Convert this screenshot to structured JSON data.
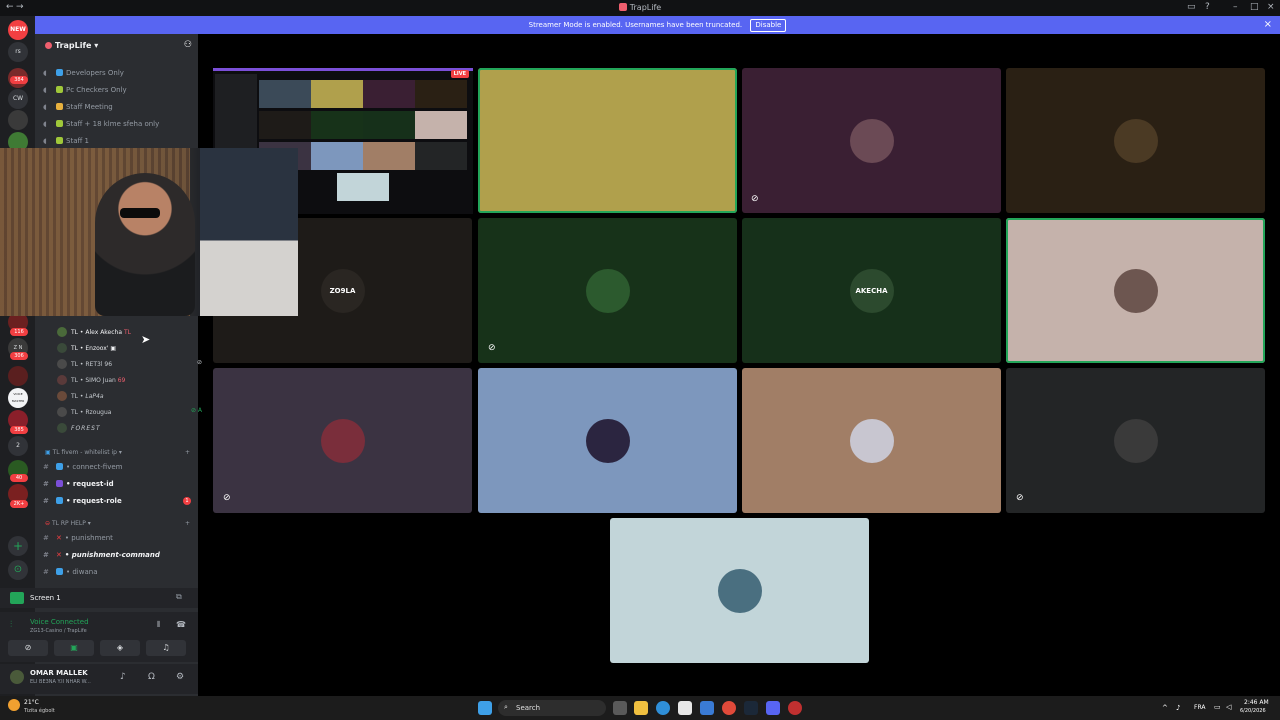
{
  "titlebar": {
    "title": "TrapLife"
  },
  "banner": {
    "text": "Streamer Mode is enabled. Usernames have been truncated.",
    "disable_label": "Disable",
    "close_icon": "close-icon"
  },
  "guilds": [
    {
      "label": "NEW",
      "badge": ""
    },
    {
      "label": "rs",
      "badge": ""
    },
    {
      "label": "",
      "badge": "384"
    },
    {
      "label": "CW",
      "badge": ""
    },
    {
      "label": "",
      "badge": "116"
    },
    {
      "label": "Z N",
      "badge": "306"
    },
    {
      "label": "VOICE MASTER",
      "badge": ""
    },
    {
      "label": "",
      "badge": "385"
    },
    {
      "label": "2",
      "badge": ""
    },
    {
      "label": "",
      "badge": "40"
    },
    {
      "label": "",
      "badge": "2K+"
    }
  ],
  "server": {
    "name": "TrapLife"
  },
  "channels_top": [
    {
      "label": "Developers Only"
    },
    {
      "label": "Pc Checkers Only"
    },
    {
      "label": "Staff Meeting"
    },
    {
      "label": "Staff + 18 klme sfeha only"
    },
    {
      "label": "Staff 1"
    }
  ],
  "members": [
    {
      "prefix": "TL",
      "name": "Alex Akecha",
      "tag": "TL"
    },
    {
      "prefix": "TL",
      "name": "Enzoox'",
      "tag": ""
    },
    {
      "prefix": "TL",
      "name": "RET3l 96",
      "tag": ""
    },
    {
      "prefix": "TL",
      "name": "SIMO Juan",
      "tag": "69"
    },
    {
      "prefix": "TL",
      "name": "LaP4a",
      "tag": ""
    },
    {
      "prefix": "TL",
      "name": "Rzougua",
      "tag": ""
    },
    {
      "prefix": "",
      "name": "FOREST",
      "tag": ""
    }
  ],
  "category_fivem": {
    "label": "TL fivem - whitelist ip"
  },
  "fivem_channels": [
    {
      "label": "connect-fivem",
      "bold": false,
      "badge": ""
    },
    {
      "label": "request-id",
      "bold": true,
      "badge": ""
    },
    {
      "label": "request-role",
      "bold": true,
      "badge": "1"
    }
  ],
  "category_help": {
    "label": "TL RP HELP"
  },
  "help_channels": [
    {
      "label": "punishment"
    },
    {
      "label": "punishment-command"
    },
    {
      "label": "diwana"
    }
  ],
  "screen_panel": {
    "label": "Screen 1"
  },
  "voice": {
    "status": "Voice Connected",
    "channel": "ZG13-Casino / TrapLife"
  },
  "user": {
    "name": "OMAR MALLEK",
    "status": "ELI BE3NA Y.II NHAR W..."
  },
  "tiles": [
    {
      "label": "",
      "bg": "#b0a04c",
      "avatar_bg": "#b0a04c",
      "speaking": true,
      "muted": false,
      "deaf": true
    },
    {
      "label": "",
      "bg": "#3a1f33",
      "avatar_bg": "#6b4a55",
      "speaking": false,
      "muted": false,
      "deaf": false
    },
    {
      "label": "",
      "bg": "#2a2014",
      "avatar_bg": "#4b3a24",
      "speaking": false,
      "muted": false,
      "deaf": false
    },
    {
      "label": "ZO9LA",
      "bg": "#1e1b18",
      "avatar_bg": "#2a2622",
      "speaking": false,
      "muted": false,
      "deaf": false
    },
    {
      "label": "",
      "bg": "#173219",
      "avatar_bg": "#2c5a2e",
      "speaking": false,
      "muted": true,
      "deaf": false
    },
    {
      "label": "AKECHA",
      "bg": "#16301a",
      "avatar_bg": "#2c4a2e",
      "speaking": false,
      "muted": false,
      "deaf": false
    },
    {
      "label": "",
      "bg": "#c5b2ab",
      "avatar_bg": "#6d5650",
      "speaking": true,
      "muted": false,
      "deaf": false
    },
    {
      "label": "",
      "bg": "#3b3342",
      "avatar_bg": "#7a2e3b",
      "speaking": false,
      "muted": true,
      "deaf": false
    },
    {
      "label": "",
      "bg": "#7d97bd",
      "avatar_bg": "#2b2540",
      "speaking": false,
      "muted": false,
      "deaf": false
    },
    {
      "label": "",
      "bg": "#a17e66",
      "avatar_bg": "#c8c6d0",
      "speaking": false,
      "muted": false,
      "deaf": false
    },
    {
      "label": "",
      "bg": "#232526",
      "avatar_bg": "#3a3a3a",
      "speaking": false,
      "muted": true,
      "deaf": false
    },
    {
      "label": "",
      "bg": "#c2d5d9",
      "avatar_bg": "#4a6f80",
      "speaking": false,
      "muted": false,
      "deaf": false
    }
  ],
  "screenshare": {
    "live_label": "LIVE"
  },
  "taskbar": {
    "weather_temp": "21°C",
    "weather_desc": "Tizita égbolt",
    "search": "Search",
    "lang": "FRA",
    "time": "2:46 AM",
    "date": "6/20/2026"
  }
}
